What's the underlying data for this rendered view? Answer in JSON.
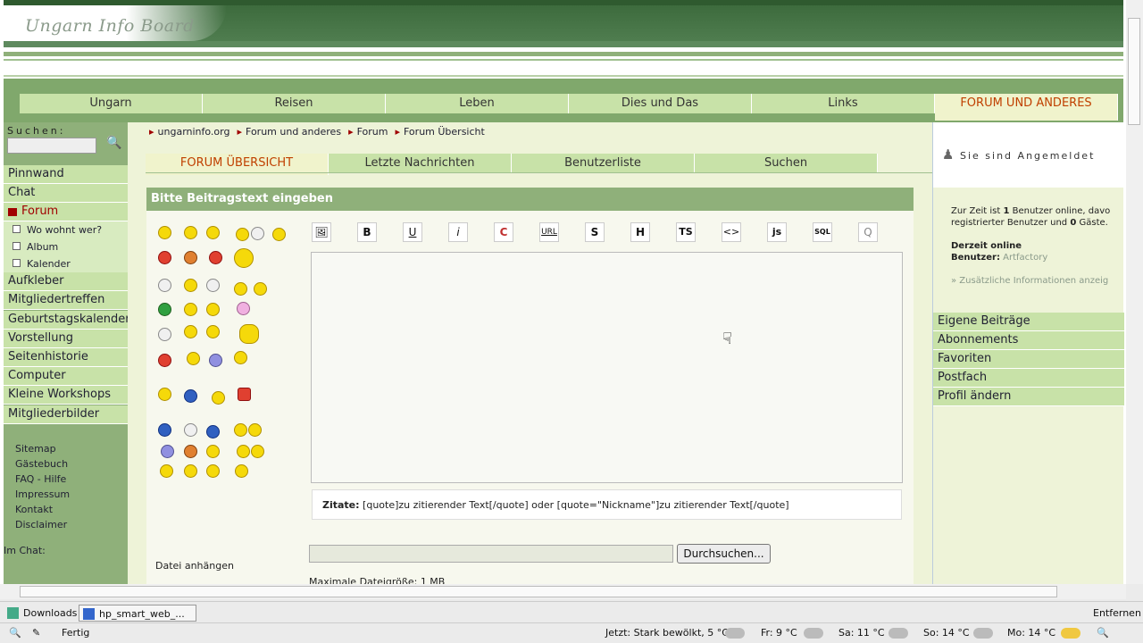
{
  "header": {
    "logo_text": "Ungarn Info Board"
  },
  "top_nav": {
    "items": [
      "Ungarn",
      "Reisen",
      "Leben",
      "Dies und Das",
      "Links",
      "FORUM UND ANDERES"
    ],
    "active_index": 5
  },
  "sidebar": {
    "search_label": "Suchen:",
    "items": [
      "Pinnwand",
      "Chat",
      "Forum",
      "Wo wohnt wer?",
      "Album",
      "Kalender",
      "Aufkleber",
      "Mitgliedertreffen",
      "Geburtstagskalender",
      "Vorstellung",
      "Seitenhistorie",
      "Computer",
      "Kleine Workshops",
      "Mitgliederbilder"
    ],
    "footer_links": [
      "Sitemap",
      "Gästebuch",
      "FAQ - Hilfe",
      "Impressum",
      "Kontakt",
      "Disclaimer"
    ],
    "chat_label": "Im Chat:"
  },
  "breadcrumb": [
    "ungarninfo.org",
    "Forum und anderes",
    "Forum",
    "Forum Übersicht"
  ],
  "tabs": [
    "FORUM ÜBERSICHT",
    "Letzte Nachrichten",
    "Benutzerliste",
    "Suchen"
  ],
  "form": {
    "heading": "Bitte Beitragstext eingeben",
    "toolbar": [
      "🖼",
      "B",
      "U",
      "i",
      "C",
      "URL",
      "S",
      "H",
      "TS",
      "<>",
      "js",
      "SQL",
      "Q"
    ],
    "quote_label": "Zitate:",
    "quote_hint": " [quote]zu zitierender Text[/quote] oder [quote=\"Nickname\"]zu zitierender Text[/quote]",
    "attach_label": "Datei anhängen",
    "browse_button": "Durchsuchen...",
    "max_size": "Maximale Dateigröße: 1 MB"
  },
  "right": {
    "logged_in": "Sie sind Angemeldet",
    "online_line1_pre": "Zur Zeit ist ",
    "online_count": "1",
    "online_line1_post": " Benutzer online, davo",
    "online_line2_pre": "registrierter Benutzer und ",
    "guest_count": "0",
    "online_line2_post": " Gäste.",
    "now_online": "Derzeit online",
    "users_label": "Benutzer:",
    "user_name": "Artfactory",
    "more_info": "» Zusätzliche Informationen anzeig",
    "menu": [
      "Eigene Beiträge",
      "Abonnements",
      "Favoriten",
      "Postfach",
      "Profil ändern"
    ]
  },
  "downloads_bar": {
    "items": [
      "Downloads",
      "hp_smart_web_..."
    ],
    "remove": "Entfernen"
  },
  "status_bar": {
    "status": "Fertig",
    "weather_now": "Jetzt: Stark bewölkt, 5 °C",
    "forecast": [
      "Fr: 9 °C",
      "Sa: 11 °C",
      "So: 14 °C",
      "Mo: 14 °C"
    ]
  },
  "colors": {
    "nav_green": "#c8e2a8",
    "dark_green": "#3d6b3d",
    "active_text": "#c04000"
  }
}
